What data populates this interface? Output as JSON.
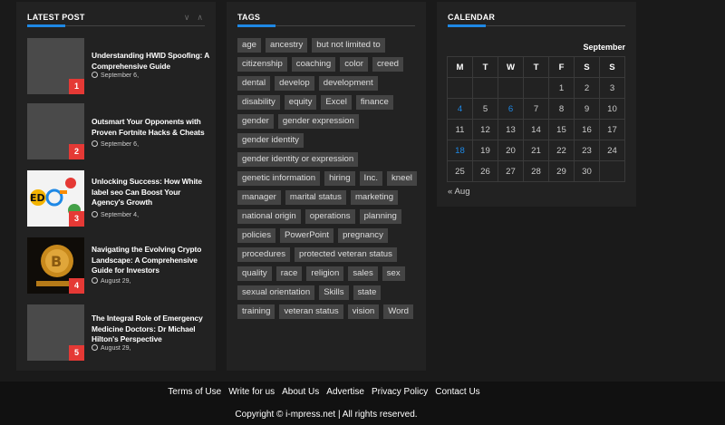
{
  "latest": {
    "title": "LATEST POST",
    "posts": [
      {
        "num": "1",
        "title": "Understanding HWID Spoofing: A Comprehensive Guide",
        "date": "September 6,"
      },
      {
        "num": "2",
        "title": "Outsmart Your Opponents with Proven Fortnite Hacks & Cheats",
        "date": "September 6,"
      },
      {
        "num": "3",
        "title": "Unlocking Success: How White label seo Can Boost Your Agency's Growth",
        "date": "September 4,"
      },
      {
        "num": "4",
        "title": "Navigating the Evolving Crypto Landscape: A Comprehensive Guide for Investors",
        "date": "August 29,"
      },
      {
        "num": "5",
        "title": "The Integral Role of Emergency Medicine Doctors: Dr Michael Hilton's Perspective",
        "date": "August 29,"
      }
    ]
  },
  "tags": {
    "title": "TAGS",
    "items": [
      "age",
      "ancestry",
      "but not limited to",
      "citizenship",
      "coaching",
      "color",
      "creed",
      "dental",
      "develop",
      "development",
      "disability",
      "equity",
      "Excel",
      "finance",
      "gender",
      "gender expression",
      "gender identity",
      "gender identity or expression",
      "genetic information",
      "hiring",
      "Inc.",
      "kneel",
      "manager",
      "marital status",
      "marketing",
      "national origin",
      "operations",
      "planning",
      "policies",
      "PowerPoint",
      "pregnancy",
      "procedures",
      "protected veteran status",
      "quality",
      "race",
      "religion",
      "sales",
      "sex",
      "sexual orientation",
      "Skills",
      "state",
      "training",
      "veteran status",
      "vision",
      "Word"
    ]
  },
  "calendar": {
    "title": "CALENDAR",
    "month": "September",
    "days": [
      "M",
      "T",
      "W",
      "T",
      "F",
      "S",
      "S"
    ],
    "weeks": [
      [
        "",
        "",
        "",
        "",
        "1",
        "2",
        "3"
      ],
      [
        "4",
        "5",
        "6",
        "7",
        "8",
        "9",
        "10"
      ],
      [
        "11",
        "12",
        "13",
        "14",
        "15",
        "16",
        "17"
      ],
      [
        "18",
        "19",
        "20",
        "21",
        "22",
        "23",
        "24"
      ],
      [
        "25",
        "26",
        "27",
        "28",
        "29",
        "30",
        ""
      ]
    ],
    "linked_days": [
      "4",
      "6",
      "18"
    ],
    "prev": "« Aug"
  },
  "footer": {
    "links": [
      "Terms of Use",
      "Write for us",
      "About Us",
      "Advertise",
      "Privacy Policy",
      "Contact Us"
    ],
    "copyright": "Copyright © i-mpress.net | All rights reserved."
  },
  "colors": {
    "accent": "#1e88e5",
    "badge": "#e53935",
    "panel": "#222222",
    "tag": "#444444"
  }
}
